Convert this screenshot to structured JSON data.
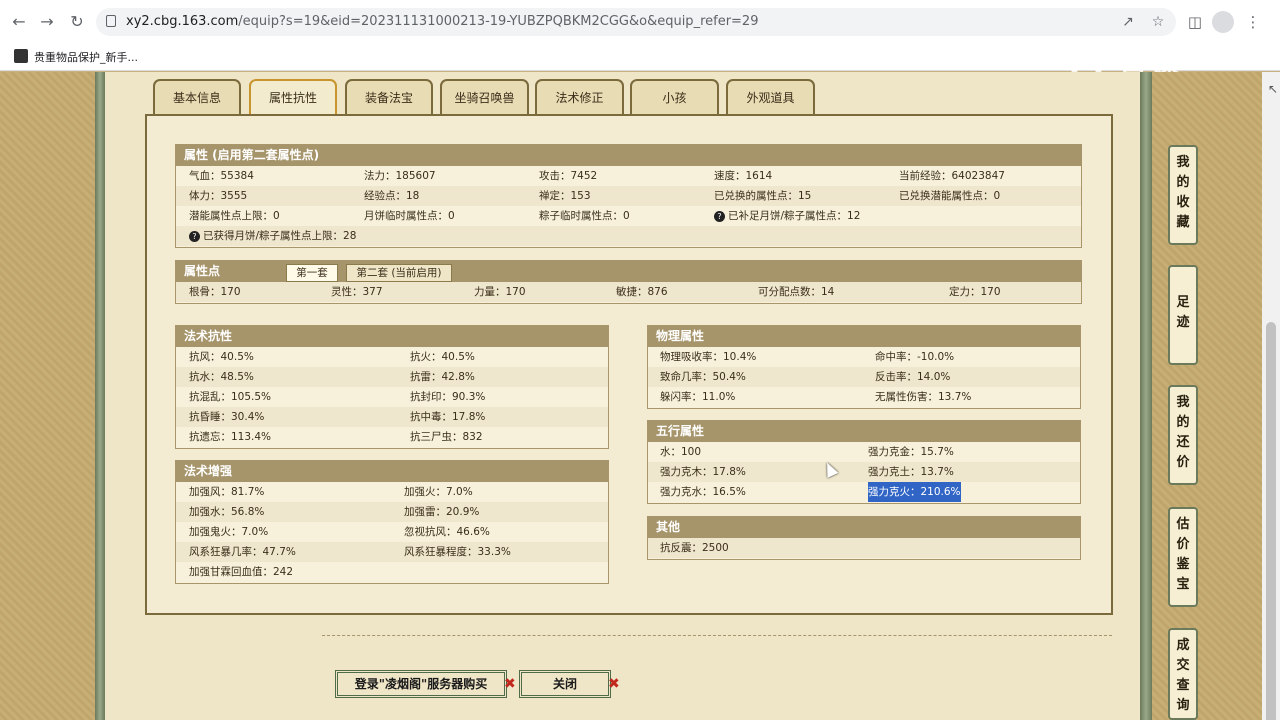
{
  "browser": {
    "url_host": "xy2.cbg.163.com",
    "url_path": "/equip?s=19&eid=202311131000213-19-YUBZPQBKM2CGG&o&equip_refer=29",
    "bookmark": "贵重物品保护_新手..."
  },
  "watermark": "CC直播",
  "tabs": [
    "基本信息",
    "属性抗性",
    "装备法宝",
    "坐骑召唤兽",
    "法术修正",
    "小孩",
    "外观道具"
  ],
  "attr": {
    "title": "属性 (启用第二套属性点)",
    "rows": [
      [
        "气血：55384",
        "法力：185607",
        "攻击：7452",
        "速度：1614",
        "当前经验：64023847"
      ],
      [
        "体力：3555",
        "经验点：18",
        "禅定：153",
        "已兑换的属性点：15",
        "已兑换潜能属性点：0"
      ],
      [
        "潜能属性点上限：0",
        "月饼临时属性点：0",
        "粽子临时属性点：0",
        "已补足月饼/粽子属性点：12",
        ""
      ],
      [
        "已获得月饼/粽子属性点上限：28",
        "",
        "",
        "",
        ""
      ]
    ]
  },
  "points": {
    "title": "属性点",
    "tab1": "第一套",
    "tab2": "第二套 (当前启用)",
    "values": [
      "根骨：170",
      "灵性：377",
      "力量：170",
      "敏捷：876",
      "可分配点数：14",
      "定力：170"
    ]
  },
  "magic_resist": {
    "title": "法术抗性",
    "rows": [
      [
        "抗风：40.5%",
        "抗火：40.5%"
      ],
      [
        "抗水：48.5%",
        "抗雷：42.8%"
      ],
      [
        "抗混乱：105.5%",
        "抗封印：90.3%"
      ],
      [
        "抗昏睡：30.4%",
        "抗中毒：17.8%"
      ],
      [
        "抗遗忘：113.4%",
        "抗三尸虫：832"
      ]
    ]
  },
  "magic_boost": {
    "title": "法术增强",
    "rows": [
      [
        "加强风：81.7%",
        "加强火：7.0%"
      ],
      [
        "加强水：56.8%",
        "加强雷：20.9%"
      ],
      [
        "加强鬼火：7.0%",
        "忽视抗风：46.6%"
      ],
      [
        "风系狂暴几率：47.7%",
        "风系狂暴程度：33.3%"
      ],
      [
        "加强甘霖回血值：242",
        ""
      ]
    ]
  },
  "physical": {
    "title": "物理属性",
    "rows": [
      [
        "物理吸收率：10.4%",
        "命中率：-10.0%"
      ],
      [
        "致命几率：50.4%",
        "反击率：14.0%"
      ],
      [
        "躲闪率：11.0%",
        "无属性伤害：13.7%"
      ]
    ]
  },
  "five_elements": {
    "title": "五行属性",
    "rows": [
      [
        "水：100",
        "强力克金：15.7%"
      ],
      [
        "强力克木：17.8%",
        "强力克土：13.7%"
      ],
      [
        "强力克水：16.5%",
        "强力克火：210.6%"
      ]
    ]
  },
  "other": {
    "title": "其他",
    "rows": [
      [
        "抗反震：2500"
      ]
    ]
  },
  "buttons": {
    "buy": "登录\"凌烟阁\"服务器购买",
    "close": "关闭"
  },
  "side_buttons": [
    [
      "我",
      "的",
      "收",
      "藏"
    ],
    [
      "足",
      "迹"
    ],
    [
      "我",
      "的",
      "还",
      "价"
    ],
    [
      "估",
      "价",
      "鉴",
      "宝"
    ],
    [
      "成",
      "交",
      "查",
      "询"
    ]
  ]
}
